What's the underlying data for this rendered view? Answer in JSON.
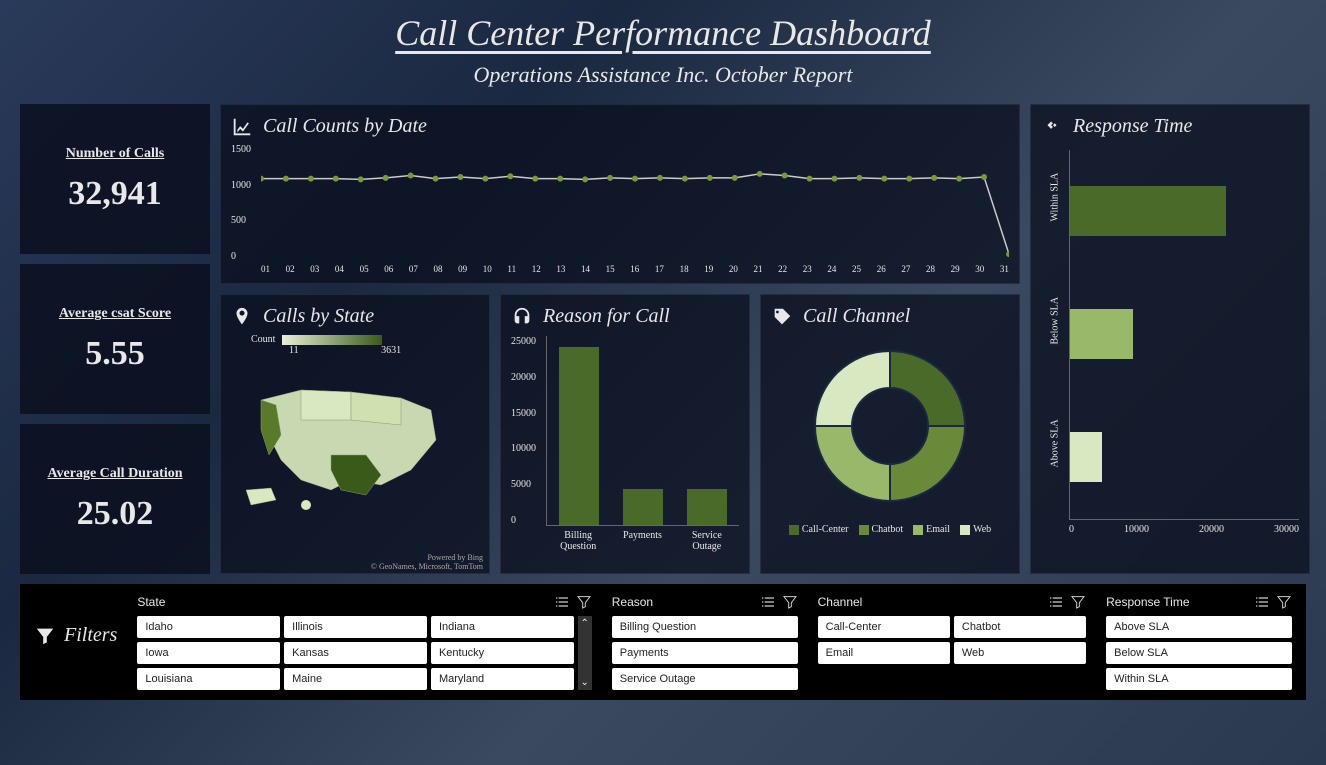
{
  "header": {
    "title": "Call Center Performance Dashboard",
    "subtitle": "Operations Assistance Inc. October Report"
  },
  "kpis": [
    {
      "label": "Number of Calls",
      "value": "32,941"
    },
    {
      "label": "Average csat Score",
      "value": "5.55"
    },
    {
      "label": "Average Call Duration",
      "value": "25.02"
    }
  ],
  "line_chart": {
    "title": "Call Counts by Date"
  },
  "map_card": {
    "title": "Calls by State",
    "legend_label": "Count",
    "legend_min": "11",
    "legend_max": "3631",
    "attrib1": "Powered by Bing",
    "attrib2": "© GeoNames, Microsoft, TomTom"
  },
  "reason_card": {
    "title": "Reason for Call"
  },
  "channel_card": {
    "title": "Call Channel",
    "legend": [
      {
        "label": "Call-Center",
        "color": "#4a6a2a"
      },
      {
        "label": "Chatbot",
        "color": "#6a8a3a"
      },
      {
        "label": "Email",
        "color": "#9ab86a"
      },
      {
        "label": "Web",
        "color": "#d8e8c0"
      }
    ]
  },
  "response_card": {
    "title": "Response Time"
  },
  "filters": {
    "title": "Filters",
    "groups": {
      "state": {
        "label": "State",
        "items": [
          "Idaho",
          "Illinois",
          "Indiana",
          "Iowa",
          "Kansas",
          "Kentucky",
          "Louisiana",
          "Maine",
          "Maryland"
        ]
      },
      "reason": {
        "label": "Reason",
        "items": [
          "Billing Question",
          "Payments",
          "Service Outage"
        ]
      },
      "channel": {
        "label": "Channel",
        "items": [
          "Call-Center",
          "Chatbot",
          "Email",
          "Web"
        ]
      },
      "response": {
        "label": "Response Time",
        "items": [
          "Above SLA",
          "Below SLA",
          "Within SLA"
        ]
      }
    }
  },
  "chart_data": [
    {
      "type": "line",
      "title": "Call Counts by Date",
      "xlabel": "",
      "ylabel": "",
      "ylim": [
        0,
        1500
      ],
      "y_ticks": [
        0,
        500,
        1000,
        1500
      ],
      "categories": [
        "01",
        "02",
        "03",
        "04",
        "05",
        "06",
        "07",
        "08",
        "09",
        "10",
        "11",
        "12",
        "13",
        "14",
        "15",
        "16",
        "17",
        "18",
        "19",
        "20",
        "21",
        "22",
        "23",
        "24",
        "25",
        "26",
        "27",
        "28",
        "29",
        "30",
        "31"
      ],
      "values": [
        1060,
        1060,
        1060,
        1060,
        1050,
        1070,
        1100,
        1060,
        1080,
        1060,
        1090,
        1060,
        1060,
        1050,
        1070,
        1060,
        1070,
        1060,
        1070,
        1070,
        1120,
        1100,
        1060,
        1060,
        1070,
        1060,
        1060,
        1070,
        1060,
        1080,
        100
      ]
    },
    {
      "type": "bar",
      "title": "Reason for Call",
      "ylim": [
        0,
        25000
      ],
      "y_ticks": [
        0,
        5000,
        10000,
        15000,
        20000,
        25000
      ],
      "categories": [
        "Billing Question",
        "Payments",
        "Service Outage"
      ],
      "values": [
        23500,
        4700,
        4800
      ]
    },
    {
      "type": "pie",
      "title": "Call Channel",
      "series": [
        {
          "name": "Call-Center",
          "value": 25,
          "color": "#4a6a2a"
        },
        {
          "name": "Chatbot",
          "value": 25,
          "color": "#6a8a3a"
        },
        {
          "name": "Email",
          "value": 25,
          "color": "#9ab86a"
        },
        {
          "name": "Web",
          "value": 25,
          "color": "#d8e8c0"
        }
      ]
    },
    {
      "type": "bar",
      "orientation": "horizontal",
      "title": "Response Time",
      "xlim": [
        0,
        30000
      ],
      "x_ticks": [
        0,
        10000,
        20000,
        30000
      ],
      "categories": [
        "Within SLA",
        "Below SLA",
        "Above SLA"
      ],
      "values": [
        20500,
        8200,
        4200
      ],
      "colors": [
        "#4a6a2a",
        "#9ab86a",
        "#d8e8c0"
      ]
    },
    {
      "type": "heatmap",
      "title": "Calls by State",
      "note": "US choropleth map; count range 11 to 3631; Texas and California appear darkest (highest)"
    }
  ]
}
